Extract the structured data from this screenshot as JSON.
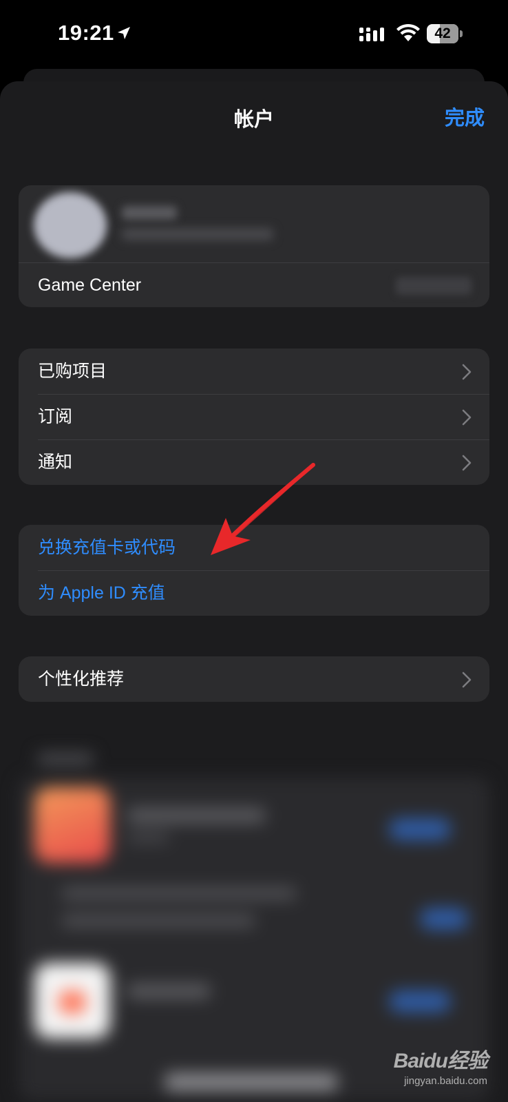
{
  "status_bar": {
    "time": "19:21",
    "battery_level": "42",
    "battery_fraction": 0.42,
    "icons": [
      "location-arrow-icon",
      "cellular-signal-icon",
      "wifi-icon",
      "battery-icon"
    ]
  },
  "nav": {
    "title": "帐户",
    "done_label": "完成"
  },
  "account": {
    "game_center_label": "Game Center"
  },
  "menu": {
    "items": [
      {
        "label": "已购项目"
      },
      {
        "label": "订阅"
      },
      {
        "label": "通知"
      }
    ]
  },
  "funds": {
    "redeem_label": "兑换充值卡或代码",
    "add_funds_label": "为 Apple ID 充值"
  },
  "personalization": {
    "label": "个性化推荐"
  },
  "colors": {
    "background": "#1c1c1e",
    "cell": "#2c2c2e",
    "accent_blue": "#2f8dff",
    "annotation_red": "#e8282a"
  },
  "watermark": {
    "logo": "Baidu经验",
    "url": "jingyan.baidu.com"
  }
}
